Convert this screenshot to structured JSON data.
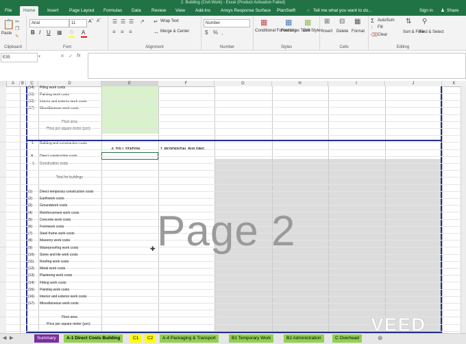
{
  "window": {
    "title": "2. Building (Civil Work) - Excel (Product Activation Failed)"
  },
  "tabs": [
    "File",
    "Home",
    "Insert",
    "Page Layout",
    "Formulas",
    "Data",
    "Review",
    "View",
    "Add-ins",
    "Ansys Response Surface",
    "PlanSwift"
  ],
  "tell_me": "Tell me what you want to do...",
  "sign_in": "Sign in",
  "share": "Share",
  "ribbon": {
    "clipboard": {
      "label": "Clipboard",
      "paste": "Paste"
    },
    "font": {
      "label": "Font",
      "name": "Arial",
      "size": "11"
    },
    "alignment": {
      "label": "Alignment",
      "wrap": "Wrap Text",
      "merge": "Merge & Center"
    },
    "number": {
      "label": "Number",
      "format": "Number"
    },
    "styles": {
      "label": "Styles",
      "cond": "Conditional Formatting",
      "table": "Format as Table",
      "cell": "Cell Styles"
    },
    "cells": {
      "label": "Cells",
      "insert": "Insert",
      "delete": "Delete",
      "format": "Format"
    },
    "editing": {
      "label": "Editing",
      "autosum": "AutoSum",
      "fill": "Fill",
      "clear": "Clear",
      "sort": "Sort & Filter",
      "find": "Find & Select"
    }
  },
  "formula_bar": {
    "name_box": "E35",
    "fx": "fx"
  },
  "columns": [
    "A",
    "B",
    "C",
    "D",
    "E",
    "F",
    "G",
    "H",
    "I",
    "J",
    "K"
  ],
  "rows_top": [
    {
      "num": "(14)",
      "label": "Piling work costs"
    },
    {
      "num": "(15)",
      "label": "Painting work costs"
    },
    {
      "num": "(16)",
      "label": "Interior and exterior work costs"
    },
    {
      "num": "(17)",
      "label": "Miscellaneous work costs"
    }
  ],
  "floor_area": "Floor area",
  "price_per_sqm": "Price per square meter (yen)",
  "section_1": {
    "num": "1.",
    "label": "Building and construction costs"
  },
  "header_e": "6. TOLL STATION",
  "header_f": "7. RESIDENTIAL BUILDING",
  "direct_costs": {
    "num": "A.",
    "label": "Direct construction costs"
  },
  "construction_costs": {
    "num": "1.",
    "label": "Construction costs"
  },
  "total_for_buildings": "Total for buildings",
  "items": [
    {
      "num": "(1)",
      "label": "Direct temporary construction costs"
    },
    {
      "num": "(2)",
      "label": "Earthwork costs"
    },
    {
      "num": "(3)",
      "label": "Groundwork costs"
    },
    {
      "num": "(4)",
      "label": "Reinforcement work costs"
    },
    {
      "num": "(5)",
      "label": "Concrete work costs"
    },
    {
      "num": "(6)",
      "label": "Formwork costs"
    },
    {
      "num": "(7)",
      "label": "Steel frame work costs"
    },
    {
      "num": "(8)",
      "label": "Masonry work costs"
    },
    {
      "num": "(9)",
      "label": "Waterproofing work costs"
    },
    {
      "num": "(10)",
      "label": "Stone and tile work costs"
    },
    {
      "num": "(11)",
      "label": "Roofing work costs"
    },
    {
      "num": "(12)",
      "label": "Metal work costs"
    },
    {
      "num": "(13)",
      "label": "Plastering work costs"
    },
    {
      "num": "(14)",
      "label": "Fitting work costs"
    },
    {
      "num": "(15)",
      "label": "Painting work costs"
    },
    {
      "num": "(16)",
      "label": "Interior and exterior work costs"
    },
    {
      "num": "(17)",
      "label": "Miscellaneous work costs"
    }
  ],
  "watermark": "Page 2",
  "sheets": [
    {
      "name": "Summary",
      "bg": "#7b2f9e",
      "fg": "#ffffff"
    },
    {
      "name": "A-1 Direct Costs Building",
      "bg": "#92d050",
      "fg": "#000000",
      "active": true
    },
    {
      "name": "C1",
      "bg": "#ffff00",
      "fg": "#000000"
    },
    {
      "name": "C2",
      "bg": "#ffff00",
      "fg": "#000000"
    },
    {
      "name": "A-4 Packaging & Transport",
      "bg": "#92d050",
      "fg": "#000000"
    },
    {
      "name": "B1 Temporary Work",
      "bg": "#92d050",
      "fg": "#000000"
    },
    {
      "name": "B2 Administration",
      "bg": "#92d050",
      "fg": "#000000"
    },
    {
      "name": "C Overhead",
      "bg": "#92d050",
      "fg": "#000000"
    }
  ],
  "brand_watermark": "VEED"
}
